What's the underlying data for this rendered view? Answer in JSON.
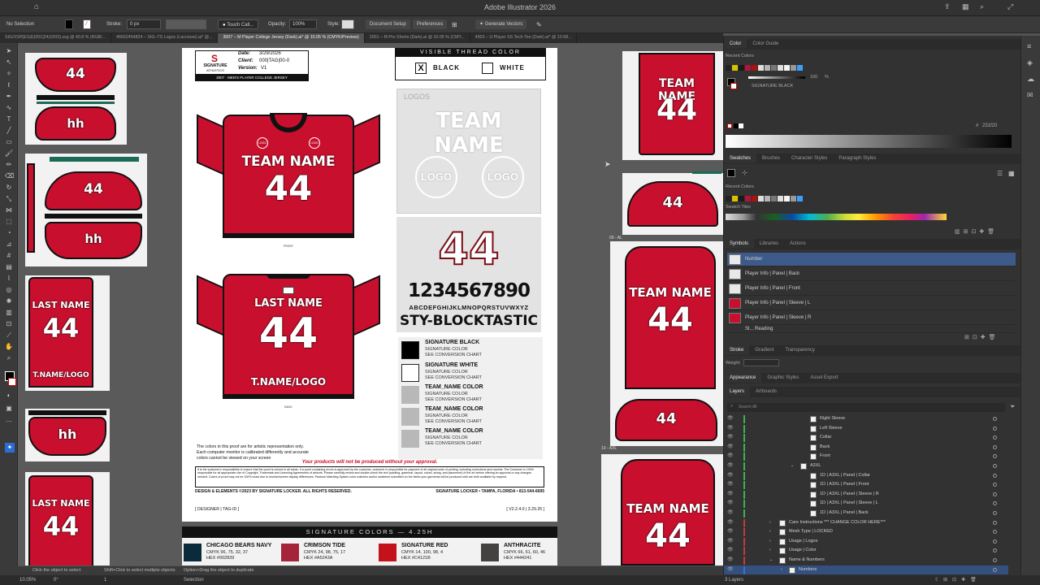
{
  "app": {
    "title": "Adobe Illustrator 2026"
  },
  "control_bar": {
    "selection": "No Selection",
    "stroke_label": "Stroke:",
    "stroke_value": "0 px",
    "brush": "Touch Call...",
    "opacity_label": "Opacity:",
    "opacity_value": "100%",
    "style_label": "Style:",
    "document_setup": "Document Setup",
    "preferences": "Preferences",
    "generate_vectors": "Generate Vectors"
  },
  "doc_tabs": [
    "SIG/XSP[EG(E)001]24(1003).svg @ 40.8 % (RGB/...",
    "46662454824 – SIG–TS Logos (Lacrosse).ai* @...",
    "3007 – M Player College Jersey (Dark).ai* @ 10.05 % (CMYK/Preview)",
    "2001 – M Pro Shorts (Dark).ai @ 10.05 % (CMY...",
    "4003 – U Player SS Tech Tee (Dark).ai* @ 10.58..."
  ],
  "artboard": {
    "date_label": "Date:",
    "date_value": "3/29/2026",
    "client_label": "Client:",
    "client_value": "000|TAG|00-0",
    "version_label": "Version:",
    "version_value": "V1",
    "logo_name": "SIGNATURE",
    "logo_sub": "ATHLETICS",
    "product_title": "3007  ·  MEN'S PLAYER COLLEGE JERSEY",
    "thread_title": "VISIBLE THREAD COLOR",
    "thread_black": "BLACK",
    "thread_black_mark": "X",
    "thread_white": "WHITE",
    "logos_heading": "LOGOS",
    "logos_team": "TEAM NAME",
    "logo_circle": "LOGO",
    "big_number": "44",
    "digits": "1234567890",
    "alphabet": "ABCDEFGHIJKLMNOPQRSTUVWXYZ",
    "font_name": "STY-BLOCKTASTIC",
    "front_label": "FRONT",
    "back_label": "BACK",
    "front_team": "TEAM NAME",
    "front_number": "44",
    "back_name": "LAST NAME",
    "back_number": "44",
    "back_logo": "T.NAME/LOGO",
    "shield_logo": "LOGO",
    "swatches": [
      {
        "title": "SIGNATURE BLACK",
        "l1": "SIGNATURE COLOR",
        "l2": "SEE CONVERSION CHART",
        "color": "#000000"
      },
      {
        "title": "SIGNATURE WHITE",
        "l1": "SIGNATURE COLOR",
        "l2": "SEE CONVERSION CHART",
        "color": "#ffffff"
      },
      {
        "title": "TEAM_NAME COLOR",
        "l1": "SIGNATURE COLOR",
        "l2": "SEE CONVERSION CHART",
        "color": "#b8b8b8"
      },
      {
        "title": "TEAM_NAME COLOR",
        "l1": "SIGNATURE COLOR",
        "l2": "SEE CONVERSION CHART",
        "color": "#b8b8b8"
      },
      {
        "title": "TEAM_NAME COLOR",
        "l1": "SIGNATURE COLOR",
        "l2": "SEE CONVERSION CHART",
        "color": "#b8b8b8"
      }
    ],
    "disclaimer1": "The colors in this proof are for artistic representation only.",
    "disclaimer2": "Each computer monitor is calibrated differently and accurate",
    "disclaimer3": "colors cannot be viewed on your screen",
    "approval_warning": "Your products will not be produced without your approval.",
    "fine_print": "It is the customer's responsibility to ensure that the proof is correct in all areas. If a proof containing errors is approved by the customer, customer is responsible for payment of all original costs of printing, including corrections and reprints. The Customer is 100% responsible for all appropriate use of Copyright, Trademark and Licensing Agreements of artwork. Please carefully review and double-check the text (spelling, grammar, layout, colors, sizing, and placement) of the art before offering an approval or any changes needed. Colors of proof may not be 100% exact due to monitor/screen display differences. Pantone Matching System color matches and/or swatches submitted on the fabric your garments will be produced with are both available by request.",
    "copyright": "DESIGN & ELEMENTS ©2023 BY SIGNATURE LOCKER. ALL RIGHTS RESERVED.",
    "company": "SIGNATURE LOCKER • TAMPA, FLORIDA • 813-544-6695",
    "footer_left": "[ DESIGNER | TAG-ID ]",
    "footer_right": "[ V2.2.4.0 | 3.29.26 ]"
  },
  "signature_colors": {
    "title": "SIGNATURE COLORS — 4.25H",
    "items": [
      {
        "name": "CHICAGO BEARS NAVY",
        "cmyk": "CMYK 96, 75, 32, 37",
        "hex": "HEX #002839",
        "color": "#0b2a3b"
      },
      {
        "name": "CRIMSON TIDE",
        "cmyk": "CMYK 24, 98, 75, 17",
        "hex": "HEX #A5243A",
        "color": "#a5243a"
      },
      {
        "name": "SIGNATURE RED",
        "cmyk": "CMYK 14, 100, 98, 4",
        "hex": "HEX #C4121B",
        "color": "#c4121b"
      },
      {
        "name": "ANTHRACITE",
        "cmyk": "CMYK 66, 61, 60, 46",
        "hex": "HEX #444241",
        "color": "#444241"
      }
    ]
  },
  "thumbs": {
    "num": "44",
    "hh": "hh",
    "team": "TEAM NAME",
    "last": "LAST NAME",
    "tlogo": "T.NAME/LOGO",
    "label1": "10 - AXL",
    "label2": "09 - AL"
  },
  "color_panel": {
    "tabs": [
      "Color",
      "Color Guide"
    ],
    "recent_colors": "Recent Colors",
    "swatch_name": "SIGNATURE BLACK",
    "value": "100",
    "pct": "%",
    "hex": "231f20"
  },
  "swatches_panel": {
    "tabs": [
      "Swatches",
      "Brushes",
      "Character Styles",
      "Paragraph Styles"
    ],
    "recent": "Recent Colors",
    "tiles": "Swatch Tiles"
  },
  "symbols_panel": {
    "tabs": [
      "Symbols",
      "Libraries",
      "Actions"
    ],
    "items": [
      "Number",
      "Player Info | Panel | Back",
      "Player Info | Panel | Front",
      "Player Info | Panel | Sleeve | L",
      "Player Info | Panel | Sleeve | R",
      "Sl... Reading"
    ]
  },
  "stroke_panel": {
    "tabs": [
      "Stroke",
      "Gradient",
      "Transparency"
    ],
    "weight_label": "Weight:"
  },
  "appearance_panel": {
    "tabs": [
      "Appearance",
      "Graphic Styles",
      "Asset Export"
    ]
  },
  "layers_panel": {
    "tabs": [
      "Layers",
      "Artboards"
    ],
    "search": "Search All",
    "rows": [
      "Right Sleeve",
      "Left Sleeve",
      "Collar",
      "Back",
      "Front",
      "A3XL",
      "1D | A3XL | Panel | Collar",
      "1D | A3XL | Panel | Front",
      "1D | A3XL | Panel | Sleeve | R",
      "1D | A3XL | Panel | Sleeve | L",
      "1D | A3XL | Panel | Back",
      "Care Instructions *** CHANGE COLOR HERE***",
      "Mesh Type | LOCKED",
      "Usage | Logos",
      "Usage | Color",
      "Name & Numbers",
      "Numbers"
    ],
    "count": "3 Layers"
  },
  "status": {
    "hint1": "Click the object to select",
    "hint2": "Shift+Click to select multiple objects",
    "hint3": "Option+Drag the object to duplicate",
    "zoom": "10.05%",
    "angle": "0°",
    "page": "1",
    "mode": "Selection"
  }
}
